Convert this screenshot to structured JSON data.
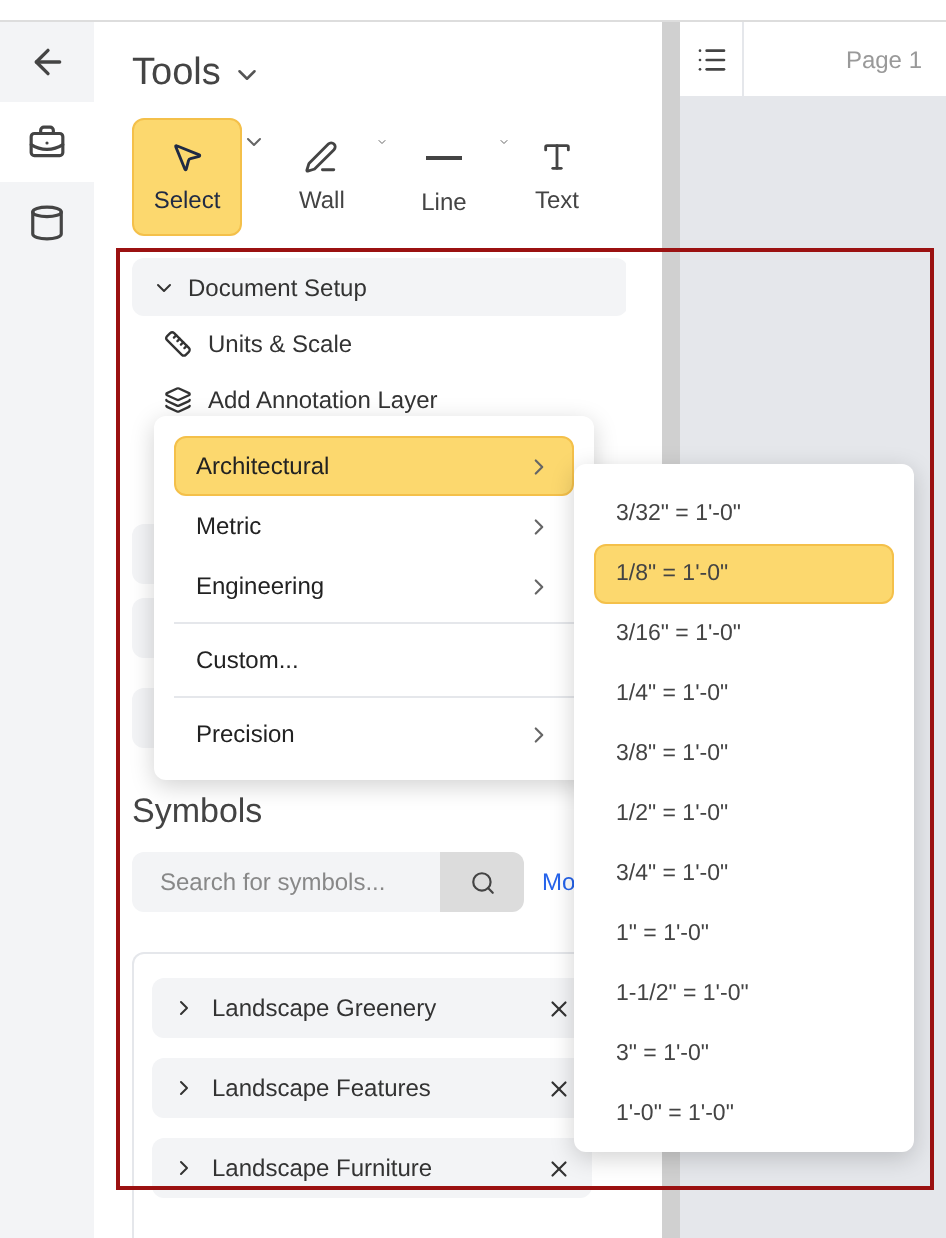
{
  "rail": {
    "items": [
      {
        "kind": "back",
        "selected": false
      },
      {
        "kind": "tools",
        "selected": true
      },
      {
        "kind": "data",
        "selected": false
      }
    ]
  },
  "panel": {
    "title": "Tools",
    "tools": [
      {
        "kind": "select",
        "label": "Select",
        "selected": true,
        "has_menu": true
      },
      {
        "kind": "wall",
        "label": "Wall",
        "selected": false,
        "has_menu": true
      },
      {
        "kind": "line",
        "label": "Line",
        "selected": false,
        "has_menu": true
      },
      {
        "kind": "text",
        "label": "Text",
        "selected": false,
        "has_menu": false
      }
    ],
    "section": {
      "title": "Document Setup",
      "expanded": true,
      "items": [
        {
          "kind": "ruler",
          "label": "Units & Scale"
        },
        {
          "kind": "layer",
          "label": "Add Annotation Layer"
        }
      ]
    },
    "symbols": {
      "title": "Symbols",
      "search": {
        "placeholder": "Search for symbols..."
      },
      "more_link": "Mo",
      "groups": [
        "Landscape Greenery",
        "Landscape Features",
        "Landscape Furniture"
      ]
    }
  },
  "page_header": {
    "title": "Page 1"
  },
  "menu": [
    {
      "label": "Architectural",
      "selected": true,
      "submenu": true
    },
    {
      "label": "Metric",
      "selected": false,
      "submenu": true
    },
    {
      "label": "Engineering",
      "selected": false,
      "submenu": true,
      "divider_after": true
    },
    {
      "label": "Custom...",
      "selected": false,
      "submenu": false,
      "divider_after": true
    },
    {
      "label": "Precision",
      "selected": false,
      "submenu": true
    }
  ],
  "submenu": [
    {
      "label": "3/32\" = 1'-0\"",
      "selected": false
    },
    {
      "label": "1/8\" = 1'-0\"",
      "selected": true
    },
    {
      "label": "3/16\" = 1'-0\"",
      "selected": false
    },
    {
      "label": "1/4\" = 1'-0\"",
      "selected": false
    },
    {
      "label": "3/8\" = 1'-0\"",
      "selected": false
    },
    {
      "label": "1/2\" = 1'-0\"",
      "selected": false
    },
    {
      "label": "3/4\" = 1'-0\"",
      "selected": false
    },
    {
      "label": "1\" = 1'-0\"",
      "selected": false
    },
    {
      "label": "1-1/2\" = 1'-0\"",
      "selected": false
    },
    {
      "label": "3\" = 1'-0\"",
      "selected": false
    },
    {
      "label": "1'-0\" = 1'-0\"",
      "selected": false
    }
  ],
  "annotation": {
    "shown": true
  }
}
